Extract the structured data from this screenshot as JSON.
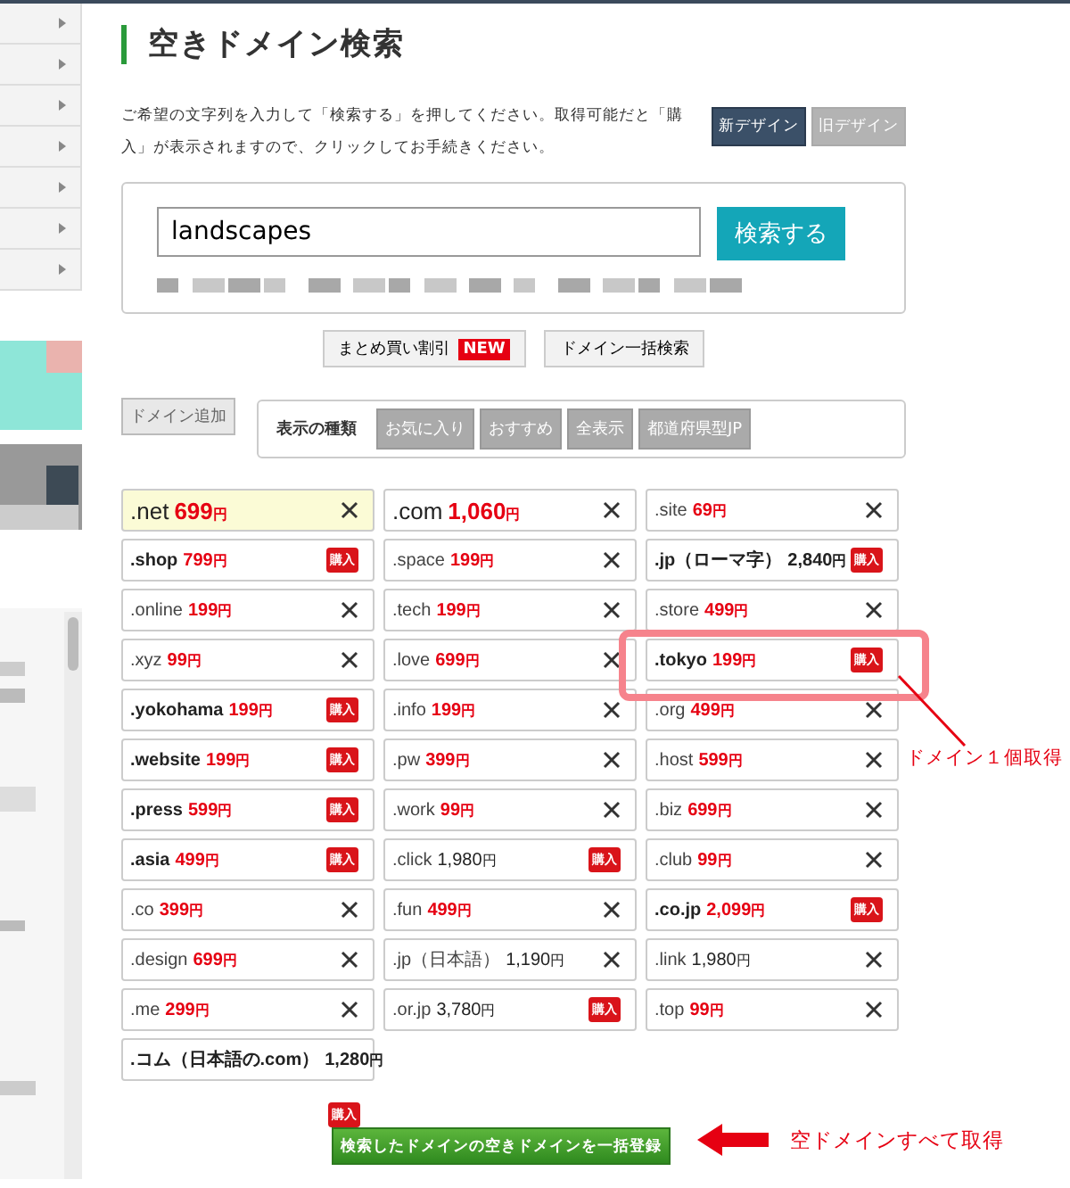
{
  "title": "空きドメイン検索",
  "description": "ご希望の文字列を入力して「検索する」を押してください。取得可能だと「購入」が表示されますので、クリックしてお手続きください。",
  "design_toggle": [
    {
      "label": "新デザイン",
      "selected": true
    },
    {
      "label": "旧デザイン",
      "selected": false
    }
  ],
  "search": {
    "value": "landscapes",
    "button": "検索する"
  },
  "links": [
    {
      "label": "まとめ買い割引",
      "badge": "NEW"
    },
    {
      "label": "ドメイン一括検索"
    }
  ],
  "add_button": "ドメイン追加",
  "filter": {
    "label": "表示の種類",
    "options": [
      "お気に入り",
      "おすすめ",
      "全表示",
      "都道府県型JP"
    ]
  },
  "results": [
    {
      "name": ".net",
      "price": "699",
      "currency": "円",
      "large": true,
      "bold": false,
      "price_red": true,
      "available": false,
      "highlighted": true
    },
    {
      "name": ".com",
      "price": "1,060",
      "currency": "円",
      "large": true,
      "bold": false,
      "price_red": true,
      "available": false,
      "highlighted": false
    },
    {
      "name": ".site",
      "price": "69",
      "currency": "円",
      "large": false,
      "bold": false,
      "price_red": true,
      "available": false,
      "highlighted": false
    },
    {
      "name": ".shop",
      "price": "799",
      "currency": "円",
      "large": false,
      "bold": true,
      "price_red": true,
      "available": true,
      "badge": "購入",
      "highlighted": false
    },
    {
      "name": ".space",
      "price": "199",
      "currency": "円",
      "large": false,
      "bold": false,
      "price_red": true,
      "available": false,
      "highlighted": false
    },
    {
      "name": ".jp（ローマ字）",
      "price": "2,840",
      "currency": "円",
      "large": false,
      "bold": true,
      "price_red": false,
      "available": true,
      "badge": "購入",
      "highlighted": false
    },
    {
      "name": ".online",
      "price": "199",
      "currency": "円",
      "large": false,
      "bold": false,
      "price_red": true,
      "available": false,
      "highlighted": false
    },
    {
      "name": ".tech",
      "price": "199",
      "currency": "円",
      "large": false,
      "bold": false,
      "price_red": true,
      "available": false,
      "highlighted": false
    },
    {
      "name": ".store",
      "price": "499",
      "currency": "円",
      "large": false,
      "bold": false,
      "price_red": true,
      "available": false,
      "highlighted": false
    },
    {
      "name": ".xyz",
      "price": "99",
      "currency": "円",
      "large": false,
      "bold": false,
      "price_red": true,
      "available": false,
      "highlighted": false
    },
    {
      "name": ".love",
      "price": "699",
      "currency": "円",
      "large": false,
      "bold": false,
      "price_red": true,
      "available": false,
      "highlighted": false
    },
    {
      "name": ".tokyo",
      "price": "199",
      "currency": "円",
      "large": false,
      "bold": true,
      "price_red": true,
      "available": true,
      "badge": "購入",
      "highlighted": false
    },
    {
      "name": ".yokohama",
      "price": "199",
      "currency": "円",
      "large": false,
      "bold": true,
      "price_red": true,
      "available": true,
      "badge": "購入",
      "highlighted": false
    },
    {
      "name": ".info",
      "price": "199",
      "currency": "円",
      "large": false,
      "bold": false,
      "price_red": true,
      "available": false,
      "highlighted": false
    },
    {
      "name": ".org",
      "price": "499",
      "currency": "円",
      "large": false,
      "bold": false,
      "price_red": true,
      "available": false,
      "highlighted": false
    },
    {
      "name": ".website",
      "price": "199",
      "currency": "円",
      "large": false,
      "bold": true,
      "price_red": true,
      "available": true,
      "badge": "購入",
      "highlighted": false
    },
    {
      "name": ".pw",
      "price": "399",
      "currency": "円",
      "large": false,
      "bold": false,
      "price_red": true,
      "available": false,
      "highlighted": false
    },
    {
      "name": ".host",
      "price": "599",
      "currency": "円",
      "large": false,
      "bold": false,
      "price_red": true,
      "available": false,
      "highlighted": false
    },
    {
      "name": ".press",
      "price": "599",
      "currency": "円",
      "large": false,
      "bold": true,
      "price_red": true,
      "available": true,
      "badge": "購入",
      "highlighted": false
    },
    {
      "name": ".work",
      "price": "99",
      "currency": "円",
      "large": false,
      "bold": false,
      "price_red": true,
      "available": false,
      "highlighted": false
    },
    {
      "name": ".biz",
      "price": "699",
      "currency": "円",
      "large": false,
      "bold": false,
      "price_red": true,
      "available": false,
      "highlighted": false
    },
    {
      "name": ".asia",
      "price": "499",
      "currency": "円",
      "large": false,
      "bold": true,
      "price_red": true,
      "available": true,
      "badge": "購入",
      "highlighted": false
    },
    {
      "name": ".click",
      "price": "1,980",
      "currency": "円",
      "large": false,
      "bold": false,
      "price_red": false,
      "available": true,
      "badge": "購入",
      "highlighted": false
    },
    {
      "name": ".club",
      "price": "99",
      "currency": "円",
      "large": false,
      "bold": false,
      "price_red": true,
      "available": false,
      "highlighted": false
    },
    {
      "name": ".co",
      "price": "399",
      "currency": "円",
      "large": false,
      "bold": false,
      "price_red": true,
      "available": false,
      "highlighted": false
    },
    {
      "name": ".fun",
      "price": "499",
      "currency": "円",
      "large": false,
      "bold": false,
      "price_red": true,
      "available": false,
      "highlighted": false
    },
    {
      "name": ".co.jp",
      "price": "2,099",
      "currency": "円",
      "large": false,
      "bold": true,
      "price_red": true,
      "available": true,
      "badge": "購入",
      "highlighted": false
    },
    {
      "name": ".design",
      "price": "699",
      "currency": "円",
      "large": false,
      "bold": false,
      "price_red": true,
      "available": false,
      "highlighted": false
    },
    {
      "name": ".jp（日本語）",
      "price": "1,190",
      "currency": "円",
      "large": false,
      "bold": false,
      "price_red": false,
      "available": false,
      "highlighted": false
    },
    {
      "name": ".link",
      "price": "1,980",
      "currency": "円",
      "large": false,
      "bold": false,
      "price_red": false,
      "available": false,
      "highlighted": false
    },
    {
      "name": ".me",
      "price": "299",
      "currency": "円",
      "large": false,
      "bold": false,
      "price_red": true,
      "available": false,
      "highlighted": false
    },
    {
      "name": ".or.jp",
      "price": "3,780",
      "currency": "円",
      "large": false,
      "bold": false,
      "price_red": false,
      "available": true,
      "badge": "購入",
      "highlighted": false
    },
    {
      "name": ".top",
      "price": "99",
      "currency": "円",
      "large": false,
      "bold": false,
      "price_red": true,
      "available": false,
      "highlighted": false
    },
    {
      "name": ".コム（日本語の.com）",
      "price": "1,280",
      "currency": "円",
      "large": false,
      "bold": true,
      "price_red": false,
      "highlighted": false
    }
  ],
  "bulk_register": {
    "badge": "購入",
    "label": "検索したドメインの空きドメインを一括登録"
  },
  "annotations": [
    {
      "text": "ドメイン１個取得"
    },
    {
      "text": "空ドメインすべて取得"
    }
  ]
}
